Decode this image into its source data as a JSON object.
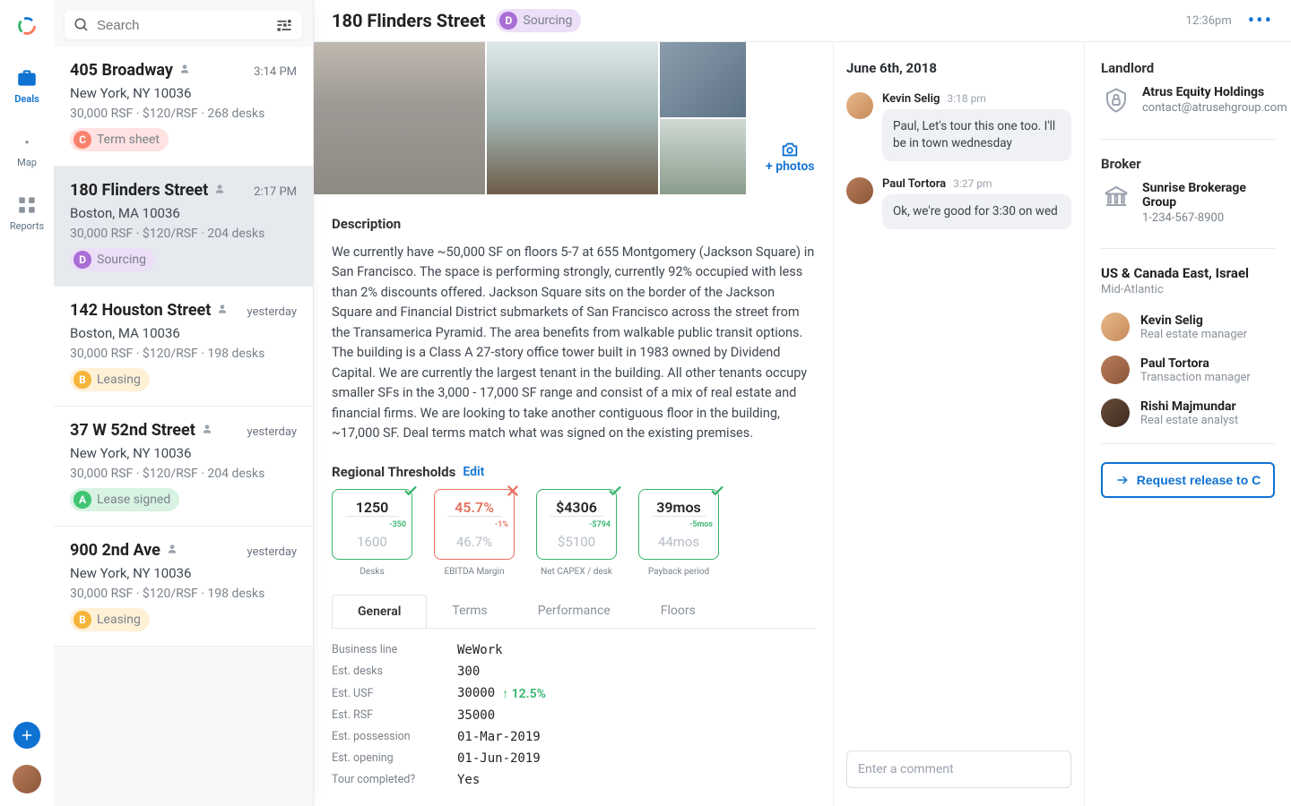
{
  "rail": {
    "deals": "Deals",
    "map": "Map",
    "reports": "Reports"
  },
  "search": {
    "placeholder": "Search"
  },
  "deals": [
    {
      "address": "405 Broadway",
      "time": "3:14 PM",
      "city": "New York, NY 10036",
      "stats": "30,000 RSF · $120/RSF · 268 desks",
      "stage_letter": "C",
      "stage": "Term sheet",
      "pill_bg": "#ffe2e1",
      "badge_bg": "#f9826c",
      "pill_color": "#7a828b"
    },
    {
      "address": "180 Flinders Street",
      "time": "2:17 PM",
      "city": "Boston, MA 10036",
      "stats": "30,000 RSF · $120/RSF · 204 desks",
      "stage_letter": "D",
      "stage": "Sourcing",
      "pill_bg": "#ecdff7",
      "badge_bg": "#a96ed6",
      "pill_color": "#7a828b"
    },
    {
      "address": "142 Houston Street",
      "time": "yesterday",
      "city": "Boston, MA 10036",
      "stats": "30,000 RSF · $120/RSF · 198 desks",
      "stage_letter": "B",
      "stage": "Leasing",
      "pill_bg": "#fff1d6",
      "badge_bg": "#f5b43a",
      "pill_color": "#7a828b"
    },
    {
      "address": "37 W 52nd Street",
      "time": "yesterday",
      "city": "New York, NY 10036",
      "stats": "30,000 RSF · $120/RSF · 204 desks",
      "stage_letter": "A",
      "stage": "Lease signed",
      "pill_bg": "#d8f3e2",
      "badge_bg": "#3fc574",
      "pill_color": "#7a828b"
    },
    {
      "address": "900 2nd Ave",
      "time": "yesterday",
      "city": "New York, NY 10036",
      "stats": "30,000 RSF · $120/RSF · 198 desks",
      "stage_letter": "B",
      "stage": "Leasing",
      "pill_bg": "#fff1d6",
      "badge_bg": "#f5b43a",
      "pill_color": "#7a828b"
    }
  ],
  "header": {
    "title": "180 Flinders Street",
    "time": "12:36pm",
    "stage_letter": "D",
    "stage": "Sourcing"
  },
  "photos": {
    "add": "+ photos"
  },
  "description": {
    "heading": "Description",
    "body": "We currently have ~50,000 SF on floors 5-7 at 655 Montgomery (Jackson Square) in San Francisco. The space is performing strongly, currently 92% occupied with less than 2% discounts offered. Jackson Square sits on the border of the Jackson Square and Financial District submarkets of San Francisco across the street from the Transamerica Pyramid. The area benefits from walkable public transit options. The building is a Class A 27-story office tower built in 1983 owned by Dividend Capital. We are currently the largest tenant in the building. All other tenants occupy smaller SFs in the 3,000 - 17,000 SF range and consist of a mix of real estate and financial firms. We are looking to take another contiguous floor in the building, ~17,000 SF. Deal terms match what was signed on the existing premises."
  },
  "thresholds": {
    "heading": "Regional Thresholds",
    "edit": "Edit",
    "cards": [
      {
        "v1": "1250",
        "delta": "-350",
        "v2": "1600",
        "label": "Desks",
        "ok": true
      },
      {
        "v1": "45.7%",
        "delta": "-1%",
        "v2": "46.7%",
        "label": "EBITDA Margin",
        "ok": false
      },
      {
        "v1": "$4306",
        "delta": "-$794",
        "v2": "$5100",
        "label": "Net CAPEX / desk",
        "ok": true
      },
      {
        "v1": "39mos",
        "delta": "-5mos",
        "v2": "44mos",
        "label": "Payback period",
        "ok": true
      }
    ]
  },
  "tabs": [
    "General",
    "Terms",
    "Performance",
    "Floors"
  ],
  "kv": [
    {
      "k": "Business line",
      "v": "WeWork"
    },
    {
      "k": "Est. desks",
      "v": "300"
    },
    {
      "k": "Est. USF",
      "v": "30000",
      "trend": "↑ 12.5%"
    },
    {
      "k": "Est. RSF",
      "v": "35000"
    },
    {
      "k": "Est. possession",
      "v": "01-Mar-2019"
    },
    {
      "k": "Est. opening",
      "v": "01-Jun-2019"
    },
    {
      "k": "Tour completed?",
      "v": "Yes"
    }
  ],
  "comments": {
    "date": "June 6th, 2018",
    "msgs": [
      {
        "name": "Kevin Selig",
        "time": "3:18 pm",
        "text": "Paul, Let's tour this one too. I'll be in town wednesday",
        "bg": "linear-gradient(135deg,#e6b88a,#c78a5a)"
      },
      {
        "name": "Paul Tortora",
        "time": "3:27 pm",
        "text": "Ok, we're good for 3:30 on wed",
        "bg": "linear-gradient(135deg,#b97d5a,#8a5638)"
      }
    ],
    "placeholder": "Enter a comment"
  },
  "meta": {
    "landlord_h": "Landlord",
    "landlord_name": "Atrus Equity Holdings",
    "landlord_contact": "contact@atrusehgroup.com",
    "broker_h": "Broker",
    "broker_name": "Sunrise Brokerage Group",
    "broker_contact": "1-234-567-8900",
    "region_t": "US & Canada East, Israel",
    "region_s": "Mid-Atlantic",
    "team": [
      {
        "name": "Kevin Selig",
        "role": "Real estate manager",
        "bg": "linear-gradient(135deg,#e6b88a,#c78a5a)"
      },
      {
        "name": "Paul Tortora",
        "role": "Transaction manager",
        "bg": "linear-gradient(135deg,#b97d5a,#8a5638)"
      },
      {
        "name": "Rishi Majmundar",
        "role": "Real estate analyst",
        "bg": "linear-gradient(135deg,#6a4d3b,#3b2a20)"
      }
    ],
    "cta": "Request release to C"
  }
}
